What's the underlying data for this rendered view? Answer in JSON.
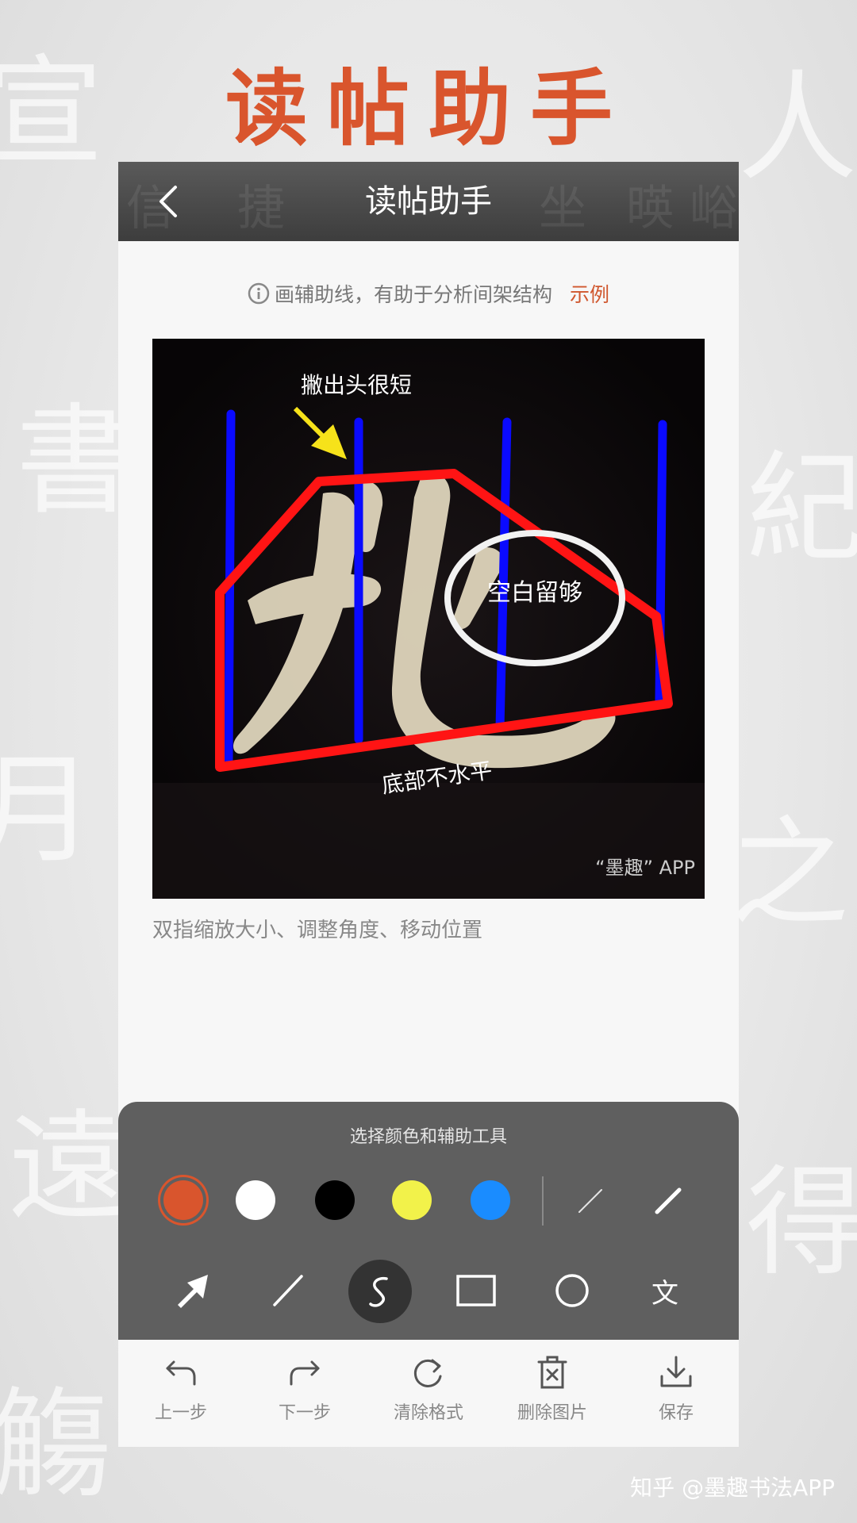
{
  "promo": {
    "title": "读帖助手"
  },
  "nav": {
    "title": "读帖助手",
    "back_icon": "chevron-left-icon"
  },
  "hint": {
    "text": "画辅助线，有助于分析间架结构",
    "link": "示例"
  },
  "canvas": {
    "annotations": {
      "top": "撇出头很短",
      "circle": "空白留够",
      "bottom": "底部不水平",
      "brand": "“墨趣” APP"
    },
    "colors": {
      "guide_red": "#ff1414",
      "guide_blue": "#0a0aff",
      "arrow": "#f6e21a"
    }
  },
  "pinch_hint": "双指缩放大小、调整角度、移动位置",
  "tool_panel": {
    "title": "选择颜色和辅助工具",
    "colors": [
      {
        "name": "orange",
        "hex": "#d9552d",
        "selected": true
      },
      {
        "name": "white",
        "hex": "#ffffff",
        "selected": false
      },
      {
        "name": "black",
        "hex": "#000000",
        "selected": false
      },
      {
        "name": "yellow",
        "hex": "#f2f24a",
        "selected": false
      },
      {
        "name": "blue",
        "hex": "#1a8cff",
        "selected": false
      }
    ],
    "stroke_widths": [
      "thin",
      "thick"
    ],
    "tools": [
      {
        "name": "arrow",
        "icon": "arrow-icon"
      },
      {
        "name": "line",
        "icon": "line-icon"
      },
      {
        "name": "freehand",
        "icon": "freehand-icon",
        "active": true
      },
      {
        "name": "rectangle",
        "icon": "rectangle-icon"
      },
      {
        "name": "circle",
        "icon": "circle-icon"
      },
      {
        "name": "text",
        "icon": "text-icon",
        "glyph": "文"
      }
    ]
  },
  "bottom_bar": [
    {
      "label": "上一步",
      "icon": "undo-icon"
    },
    {
      "label": "下一步",
      "icon": "redo-icon"
    },
    {
      "label": "清除格式",
      "icon": "refresh-icon"
    },
    {
      "label": "删除图片",
      "icon": "delete-image-icon"
    },
    {
      "label": "保存",
      "icon": "download-icon"
    }
  ],
  "watermark": "知乎 @墨趣书法APP"
}
